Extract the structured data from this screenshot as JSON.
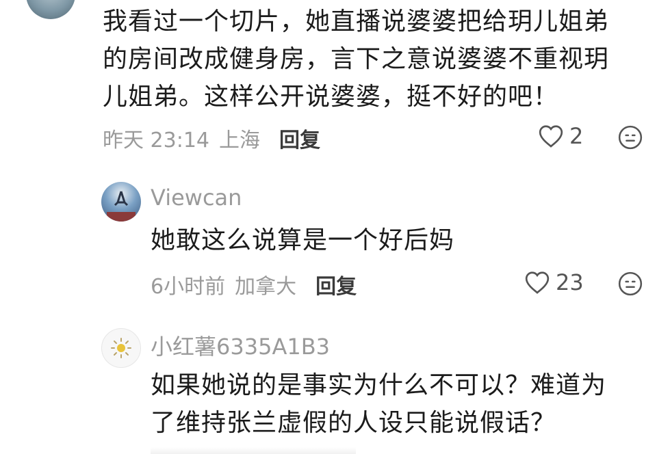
{
  "comments": [
    {
      "text_lines": [
        "我看过一个切片，她直播说婆婆把给玥儿姐弟",
        "的房间改成健身房，言下之意说婆婆不重视玥",
        "儿姐弟。这样公开说婆婆，挺不好的吧！"
      ],
      "time": "昨天 23:14",
      "location": "上海",
      "reply_label": "回复",
      "likes": "2",
      "icons": [
        "avatar",
        "heart-icon",
        "emoji-icon"
      ]
    },
    {
      "username": "Viewcan",
      "text": "她敢这么说算是一个好后妈",
      "time": "6小时前",
      "location": "加拿大",
      "reply_label": "回复",
      "likes": "23",
      "icons": [
        "avatar",
        "heart-icon",
        "emoji-icon"
      ]
    },
    {
      "username": "小红薯6335A1B3",
      "text_lines": [
        "如果她说的是事实为什么不可以？难道为",
        "了维持张兰虚假的人设只能说假话？"
      ],
      "icons": [
        "sun-avatar-icon"
      ]
    }
  ],
  "colors": {
    "text": "#1b1b1b",
    "meta": "#9a9a9a",
    "background": "#ffffff"
  }
}
